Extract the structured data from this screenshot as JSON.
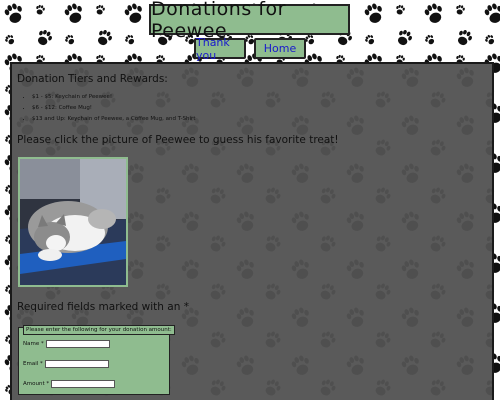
{
  "header": {
    "title": "Donations for Peewee"
  },
  "nav": {
    "thanks_label": "Thank you",
    "home_label": "Home"
  },
  "main": {
    "tiers_heading": "Donation Tiers and Rewards:",
    "tiers": [
      "$1 - $5: Keychain of Peewee!",
      "$6 - $12: Coffee Mug!",
      "$13 and Up: Keychain of Peewee, a Coffee Mug, and T-Shirt"
    ],
    "click_text": "Please click the picture of Peewee to guess his favorite treat!",
    "required_text": "Required fields marked with an *"
  },
  "form": {
    "legend": "Please enter the following for your donation amount:",
    "name_label": "Name *",
    "email_label": "Email *",
    "amount_label": "Amount *",
    "name_value": "",
    "email_value": "",
    "amount_value": ""
  },
  "colors": {
    "accent": "#8fbc8f",
    "panel": "#5a5a5a",
    "link": "#1a1acc"
  }
}
